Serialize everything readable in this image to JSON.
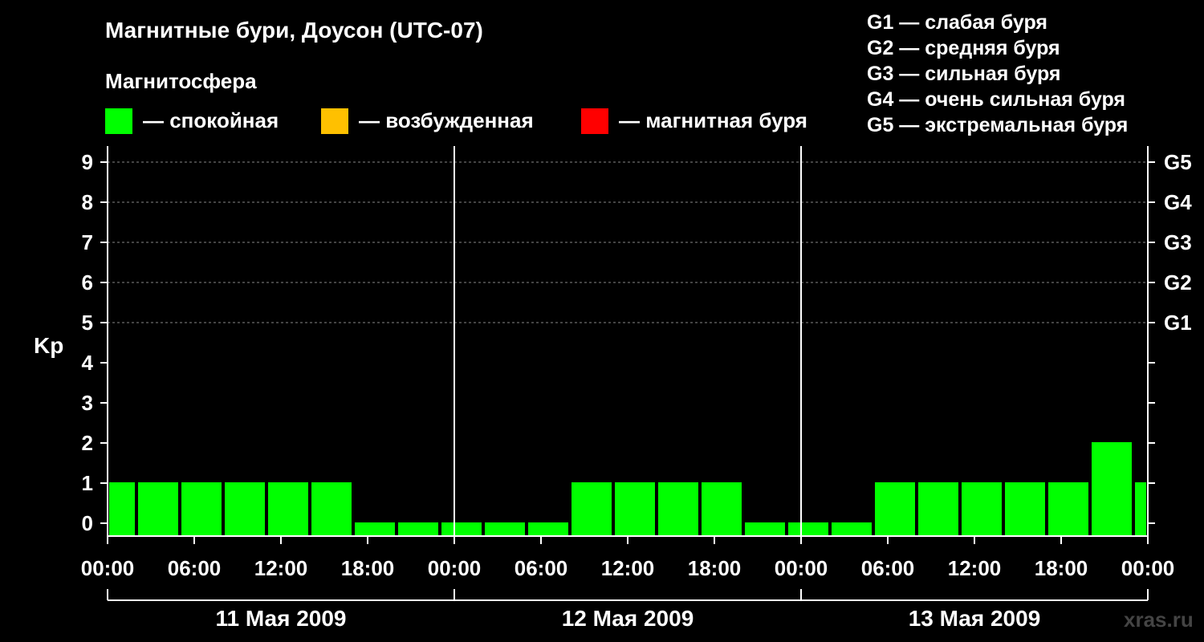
{
  "header": {
    "title": "Магнитные бури, Доусон (UTC-07)",
    "subtitle": "Магнитосфера",
    "legend": [
      {
        "label": "— спокойная",
        "color": "#00ff00"
      },
      {
        "label": "— возбужденная",
        "color": "#ffc000"
      },
      {
        "label": "— магнитная буря",
        "color": "#ff0000"
      }
    ],
    "g_levels": [
      "G1 — слабая буря",
      "G2 — средняя буря",
      "G3 — сильная буря",
      "G4 — очень сильная буря",
      "G5 — экстремальная буря"
    ]
  },
  "watermark": "xras.ru",
  "chart_data": {
    "type": "bar",
    "ylabel": "Kp",
    "ylim": [
      0,
      9
    ],
    "yticks": [
      "0",
      "1",
      "2",
      "3",
      "4",
      "5",
      "6",
      "7",
      "8",
      "9"
    ],
    "right_ticks": [
      {
        "kp": 5,
        "label": "G1"
      },
      {
        "kp": 6,
        "label": "G2"
      },
      {
        "kp": 7,
        "label": "G3"
      },
      {
        "kp": 8,
        "label": "G4"
      },
      {
        "kp": 9,
        "label": "G5"
      }
    ],
    "xticks": [
      "00:00",
      "06:00",
      "12:00",
      "18:00",
      "00:00",
      "06:00",
      "12:00",
      "18:00",
      "00:00",
      "06:00",
      "12:00",
      "18:00",
      "00:00"
    ],
    "days": [
      "11 Мая 2009",
      "12 Мая 2009",
      "13 Мая 2009"
    ],
    "bar_color": "#00ff00",
    "bars": [
      {
        "start": 0,
        "end": 2,
        "kp": 1
      },
      {
        "start": 2,
        "end": 5,
        "kp": 1
      },
      {
        "start": 5,
        "end": 8,
        "kp": 1
      },
      {
        "start": 8,
        "end": 11,
        "kp": 1
      },
      {
        "start": 11,
        "end": 14,
        "kp": 1
      },
      {
        "start": 14,
        "end": 17,
        "kp": 1
      },
      {
        "start": 17,
        "end": 20,
        "kp": 0
      },
      {
        "start": 20,
        "end": 23,
        "kp": 0
      },
      {
        "start": 23,
        "end": 26,
        "kp": 0
      },
      {
        "start": 26,
        "end": 29,
        "kp": 0
      },
      {
        "start": 29,
        "end": 32,
        "kp": 0
      },
      {
        "start": 32,
        "end": 35,
        "kp": 1
      },
      {
        "start": 35,
        "end": 38,
        "kp": 1
      },
      {
        "start": 38,
        "end": 41,
        "kp": 1
      },
      {
        "start": 41,
        "end": 44,
        "kp": 1
      },
      {
        "start": 44,
        "end": 47,
        "kp": 0
      },
      {
        "start": 47,
        "end": 50,
        "kp": 0
      },
      {
        "start": 50,
        "end": 53,
        "kp": 0
      },
      {
        "start": 53,
        "end": 56,
        "kp": 1
      },
      {
        "start": 56,
        "end": 59,
        "kp": 1
      },
      {
        "start": 59,
        "end": 62,
        "kp": 1
      },
      {
        "start": 62,
        "end": 65,
        "kp": 1
      },
      {
        "start": 65,
        "end": 68,
        "kp": 1
      },
      {
        "start": 68,
        "end": 71,
        "kp": 2
      },
      {
        "start": 71,
        "end": 72,
        "kp": 1
      }
    ]
  }
}
